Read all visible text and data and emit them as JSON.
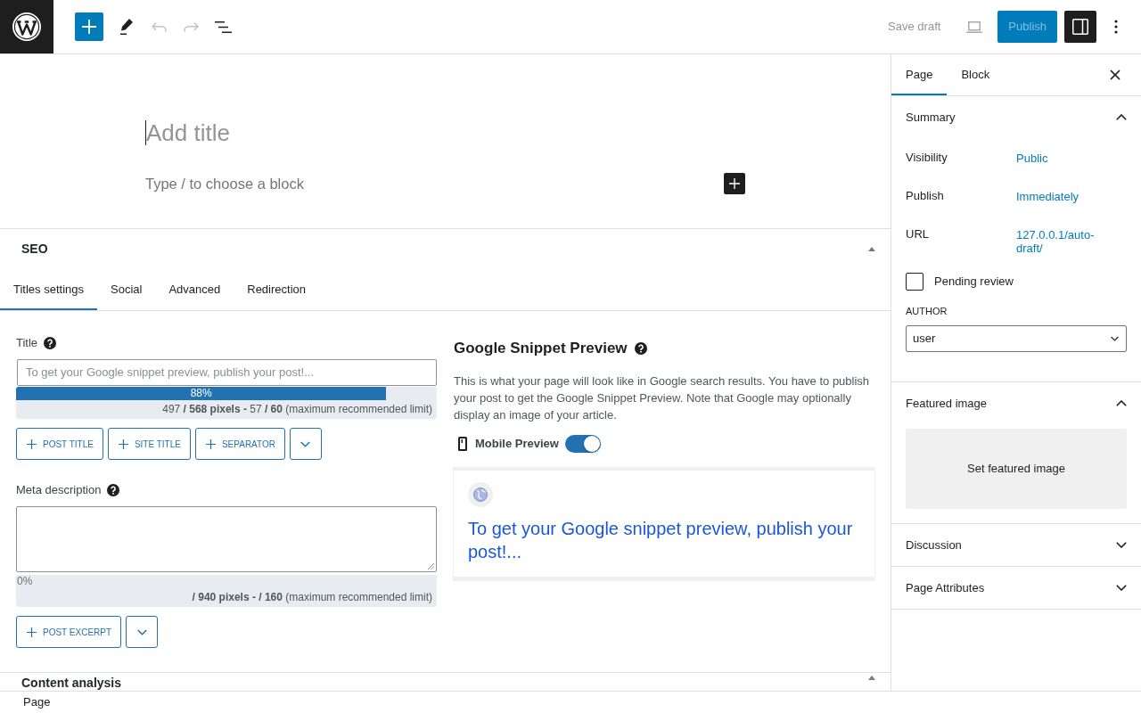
{
  "toolbar": {
    "tools": [
      {
        "kind": "inserter"
      },
      {
        "kind": "tools"
      },
      {
        "kind": "undo",
        "disabled": true
      },
      {
        "kind": "redo",
        "disabled": true
      },
      {
        "kind": "list_view"
      }
    ],
    "save_draft": {
      "label": "Save draft",
      "disabled": true
    },
    "publish": {
      "label": "Publish",
      "disabled": true
    },
    "settings_open": true
  },
  "editor": {
    "title_field": {
      "placeholder": "Add title"
    },
    "block_field": {
      "placeholder": "Type / to choose a block"
    }
  },
  "seo": {
    "title": "SEO",
    "expanded": true,
    "tabs": [
      {
        "label": "Titles settings",
        "selected": true
      },
      {
        "label": "Social",
        "selected": false
      },
      {
        "label": "Advanced",
        "selected": false
      },
      {
        "label": "Redirection",
        "selected": false
      }
    ],
    "title_field": {
      "label": "Title",
      "placeholder": "To get your Google snippet preview, publish your post!...",
      "percent": "88%",
      "level": 0.88,
      "counter": "497 **/ 568 pixels -** 57 **/ 60** (maximum recommended limit)",
      "tags": [
        "POST TITLE",
        "SITE TITLE",
        "SEPARATOR"
      ]
    },
    "meta_description": {
      "label": "Meta description",
      "percent": "0%",
      "level": 0,
      "counter": "**/ 940 pixels -** **/ 160** (maximum recommended limit)",
      "tags": [
        "POST EXCERPT"
      ]
    },
    "snippet_preview": {
      "title": "Google Snippet Preview",
      "description": "This is what your page will look like in Google search results. You have to publish your post to get the Google Snippet Preview. Note that Google may optionally display an image of your article.",
      "mobile_preview": {
        "label": "Mobile Preview",
        "on": true
      },
      "result_title": "To get your Google snippet preview, publish your post!..."
    }
  },
  "content_analysis": {
    "title": "Content analysis",
    "expanded": true
  },
  "sidebar": {
    "tabs": [
      {
        "label": "Page",
        "selected": true
      },
      {
        "label": "Block",
        "selected": false
      }
    ],
    "panels": [
      {
        "kind": "summary",
        "title": "Summary",
        "expanded": true,
        "rows": [
          {
            "label": "Visibility",
            "value": "Public"
          },
          {
            "label": "Publish",
            "value": "Immediately"
          },
          {
            "label": "URL",
            "value": "127.0.0.1/auto-draft/"
          }
        ],
        "pending_review": {
          "label": "Pending review",
          "checked": false
        },
        "author": {
          "label": "AUTHOR",
          "value": "user"
        }
      },
      {
        "kind": "featured_image",
        "title": "Featured image",
        "expanded": true,
        "button": "Set featured image"
      },
      {
        "title": "Discussion",
        "expanded": false
      },
      {
        "title": "Page Attributes",
        "expanded": false
      }
    ]
  },
  "status_bar": {
    "breadcrumb": "Page"
  }
}
